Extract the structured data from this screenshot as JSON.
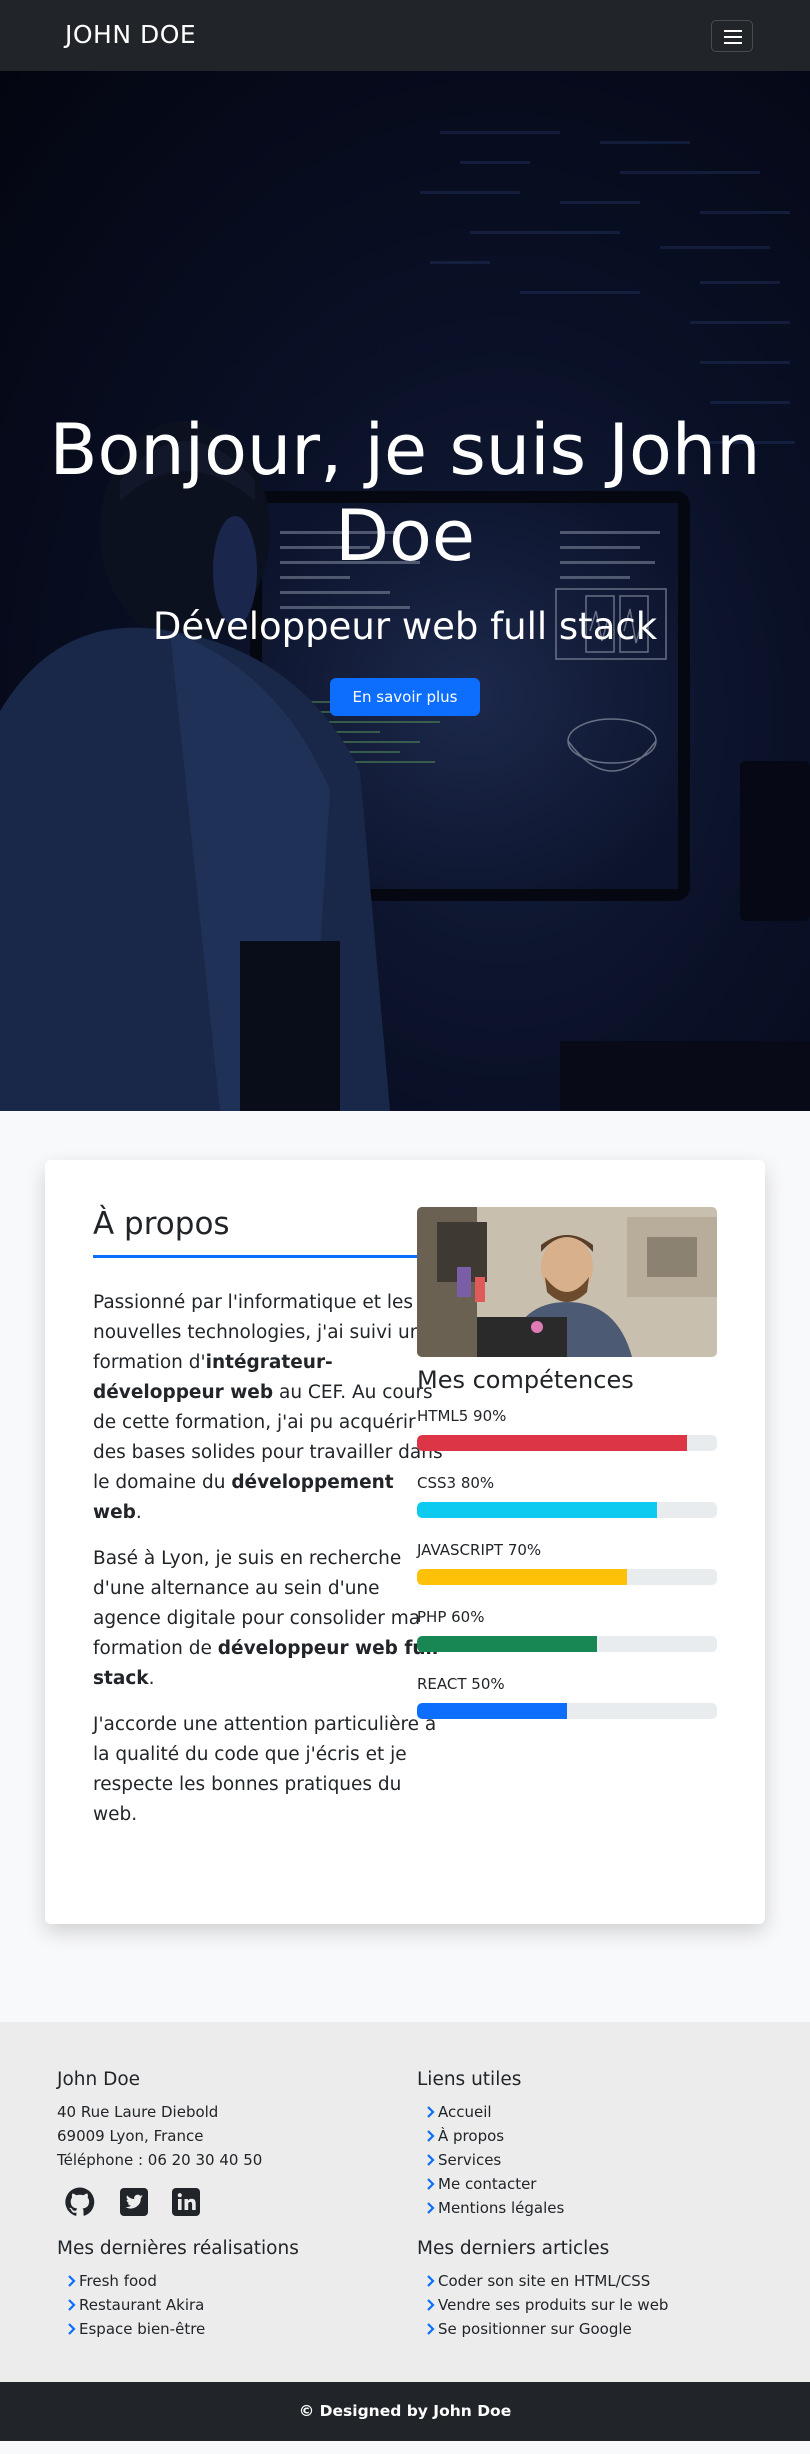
{
  "navbar": {
    "brand": "JOHN DOE",
    "menu_icon": "hamburger-menu-icon"
  },
  "hero": {
    "title": "Bonjour, je suis John Doe",
    "subtitle": "Développeur web full stack",
    "cta_label": "En savoir plus"
  },
  "about": {
    "title": "À propos",
    "paragraphs": [
      [
        "Passionné par l'informatique et les nouvelles technologies, j'ai suivi une formation d'",
        "intégrateur-développeur web",
        " au CEF. Au cours de cette formation, j'ai pu acquérir des bases solides pour travailler dans le domaine du ",
        "développement web",
        "."
      ],
      [
        "Basé à Lyon, je suis en recherche d'une alternance au sein d'une agence digitale pour consolider ma formation de ",
        "développeur web full stack",
        "."
      ],
      [
        "J'accorde une attention particulière à la qualité du code que j'écris et je respecte les bonnes pratiques du web."
      ]
    ]
  },
  "skills": {
    "title": "Mes compétences",
    "items": [
      {
        "label": "HTML5 90%",
        "value": 90,
        "color": "#dc3545"
      },
      {
        "label": "CSS3 80%",
        "value": 80,
        "color": "#0dcaf0"
      },
      {
        "label": "JAVASCRIPT 70%",
        "value": 70,
        "color": "#ffc107"
      },
      {
        "label": "PHP 60%",
        "value": 60,
        "color": "#198754"
      },
      {
        "label": "REACT 50%",
        "value": 50,
        "color": "#0d6efd"
      }
    ]
  },
  "footer": {
    "contact": {
      "name": "John Doe",
      "address1": "40 Rue Laure Diebold",
      "address2": "69009 Lyon, France",
      "phone": "Téléphone : 06 20 30 40 50",
      "socials": [
        "github-icon",
        "twitter-icon",
        "linkedin-icon"
      ]
    },
    "useful_links": {
      "title": "Liens utiles",
      "items": [
        "Accueil",
        "À propos",
        "Services",
        "Me contacter",
        "Mentions légales"
      ]
    },
    "projects": {
      "title": "Mes dernières réalisations",
      "items": [
        "Fresh food",
        "Restaurant Akira",
        "Espace bien-être"
      ]
    },
    "articles": {
      "title": "Mes derniers articles",
      "items": [
        "Coder son site en HTML/CSS",
        "Vendre ses produits sur le web",
        "Se positionner sur Google"
      ]
    },
    "copyright": "© Designed by John Doe"
  },
  "colors": {
    "accent": "#0d6efd",
    "dark": "#212529"
  }
}
